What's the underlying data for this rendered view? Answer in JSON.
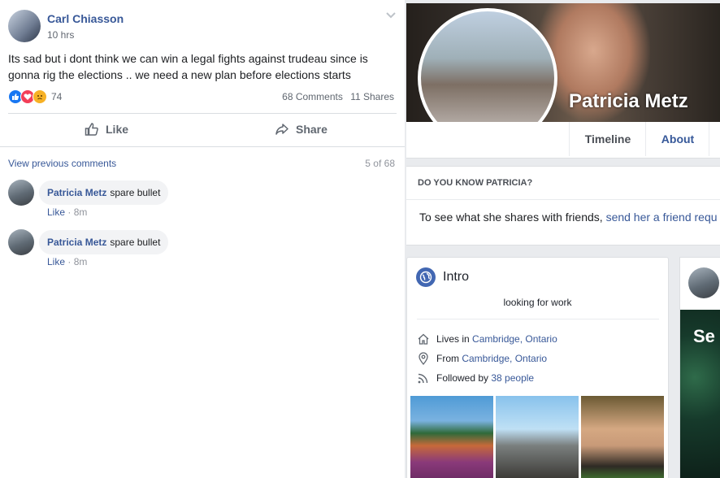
{
  "post": {
    "author": "Carl Chiasson",
    "time": "10 hrs",
    "text": "Its sad but i dont think we can win a legal fights against trudeau since is gonna rig the elections .. we need a new plan before elections starts",
    "reaction_count": "74",
    "comments_count": "68 Comments",
    "shares_count": "11 Shares",
    "actions": {
      "like": "Like",
      "share": "Share"
    },
    "view_previous": "View previous comments",
    "pager": "5 of 68",
    "comments": [
      {
        "author": "Patricia Metz",
        "text": "spare bullet",
        "like": "Like",
        "time": "· 8m"
      },
      {
        "author": "Patricia Metz",
        "text": "spare bullet",
        "like": "Like",
        "time": "· 8m"
      }
    ]
  },
  "profile": {
    "name": "Patricia Metz",
    "tabs": {
      "timeline": "Timeline",
      "about": "About"
    },
    "know": {
      "heading": "DO YOU KNOW PATRICIA?",
      "text": "To see what she shares with friends,",
      "link": "send her a friend requ"
    },
    "intro": {
      "title": "Intro",
      "bio": "looking for work",
      "lives_label": "Lives in",
      "lives_value": "Cambridge, Ontario",
      "from_label": "From",
      "from_value": "Cambridge, Ontario",
      "followed_label": "Followed by",
      "followed_value": "38 people"
    },
    "side_text": "Se"
  },
  "colors": {
    "link": "#385898",
    "like_reaction": "#1877f2",
    "love_reaction": "#f33e58",
    "sad_reaction": "#f7b125",
    "intro_icon": "#4267b2"
  },
  "icons": [
    "chevron-down-icon",
    "like-reaction-icon",
    "love-reaction-icon",
    "sad-reaction-icon",
    "thumbs-up-icon",
    "share-icon",
    "globe-icon",
    "house-icon",
    "location-pin-icon",
    "rss-feed-icon"
  ]
}
